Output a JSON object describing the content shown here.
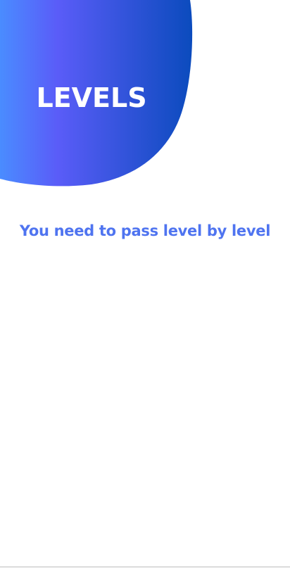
{
  "hero": {
    "title": "LEVELS",
    "gradient_start": "#4a8cff",
    "gradient_mid": "#5a5cf8",
    "gradient_end": "#0b4bbd"
  },
  "intro": {
    "subtitle": "You need to pass level by level",
    "subtitle_color": "#4f74f0"
  }
}
